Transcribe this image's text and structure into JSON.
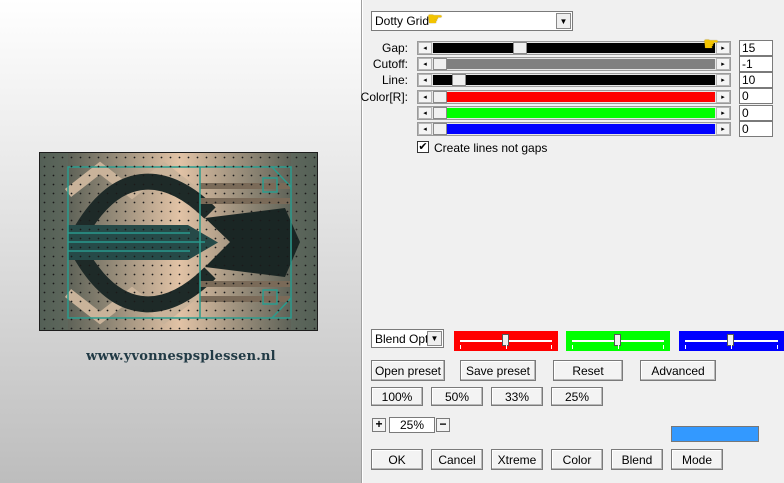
{
  "preview": {
    "watermark": "www.yvonnespsplessen.nl"
  },
  "filter": {
    "selected": "Dotty Grid"
  },
  "sliders": [
    {
      "label": "Gap:",
      "value": "15",
      "fraction": 0.3,
      "fill": "#000000"
    },
    {
      "label": "Cutoff:",
      "value": "-1",
      "fraction": 0.0,
      "fill": "#808080"
    },
    {
      "label": "Line:",
      "value": "10",
      "fraction": 0.07,
      "fill": "#000000"
    },
    {
      "label": "Color[R]:",
      "value": "0",
      "fraction": 0.0,
      "fill": "#ff0000"
    },
    {
      "label": "",
      "value": "0",
      "fraction": 0.0,
      "fill": "#00ff00"
    },
    {
      "label": "",
      "value": "0",
      "fraction": 0.0,
      "fill": "#0000ff"
    }
  ],
  "checkbox": {
    "label": "Create lines not gaps",
    "checked": "✔"
  },
  "blend": {
    "selected": "Blend Optio",
    "channel_colors": [
      "#ff0000",
      "#00ff00",
      "#0000ff"
    ]
  },
  "presets": {
    "open": "Open preset",
    "save": "Save preset",
    "reset": "Reset",
    "advanced": "Advanced"
  },
  "zoom_buttons": [
    "100%",
    "50%",
    "33%",
    "25%"
  ],
  "zoom": {
    "plus": "+",
    "minus": "−",
    "value": "25%"
  },
  "swatch_color": "#3399ff",
  "actions": {
    "ok": "OK",
    "cancel": "Cancel",
    "xtreme": "Xtreme",
    "color": "Color",
    "blend": "Blend",
    "mode": "Mode"
  }
}
